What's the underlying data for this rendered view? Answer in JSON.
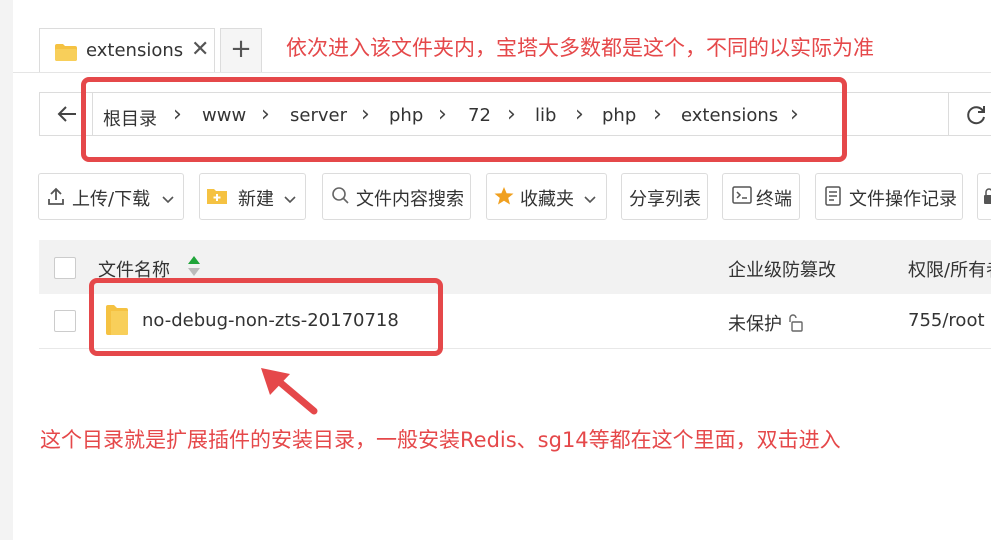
{
  "tab": {
    "label": "extensions",
    "close": "✕",
    "new": "+"
  },
  "breadcrumb": {
    "items": [
      "根目录",
      "www",
      "server",
      "php",
      "72",
      "lib",
      "php",
      "extensions"
    ]
  },
  "toolbar": {
    "upload": "上传/下载",
    "new": "新建",
    "search": "文件内容搜索",
    "favorites": "收藏夹",
    "share": "分享列表",
    "terminal": "终端",
    "oplog": "文件操作记录"
  },
  "table": {
    "headers": {
      "name": "文件名称",
      "protect": "企业级防篡改",
      "perm": "权限/所有者"
    },
    "rows": [
      {
        "name": "no-debug-non-zts-20170718",
        "protect": "未保护",
        "perm": "755/root"
      }
    ]
  },
  "annotations": {
    "top": "依次进入该文件夹内，宝塔大多数都是这个，不同的以实际为准",
    "bottom": "这个目录就是扩展插件的安装目录，一般安装Redis、sg14等都在这个里面，双击进入"
  },
  "colors": {
    "annotation": "#e5484a",
    "folder": "#f5c242",
    "favorites_star": "#f0a020"
  }
}
